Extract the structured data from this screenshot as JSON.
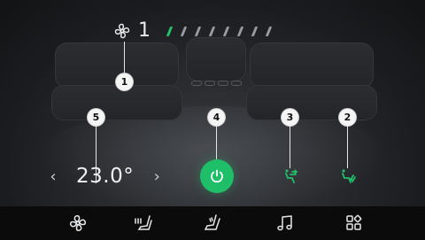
{
  "fan": {
    "icon": "fan-icon",
    "level": "1",
    "level_value": 1,
    "max_level": 8
  },
  "callouts": [
    "1",
    "2",
    "3",
    "4",
    "5"
  ],
  "temperature": {
    "value": "23.0°",
    "decrease_icon": "chevron-left-icon",
    "increase_icon": "chevron-right-icon"
  },
  "power": {
    "icon": "power-icon",
    "state": "on"
  },
  "airflow": [
    {
      "icon": "airflow-upper-body-icon"
    },
    {
      "icon": "airflow-feet-icon"
    }
  ],
  "navbar": {
    "items": [
      {
        "icon": "fan-icon"
      },
      {
        "icon": "seat-heat-icon"
      },
      {
        "icon": "seat-icon"
      },
      {
        "icon": "music-icon"
      },
      {
        "icon": "apps-icon"
      }
    ]
  },
  "colors": {
    "accent": "#1fbf6a",
    "background": "#1f2023",
    "navbar": "#0b0b0c",
    "text": "#f0f1f3"
  }
}
